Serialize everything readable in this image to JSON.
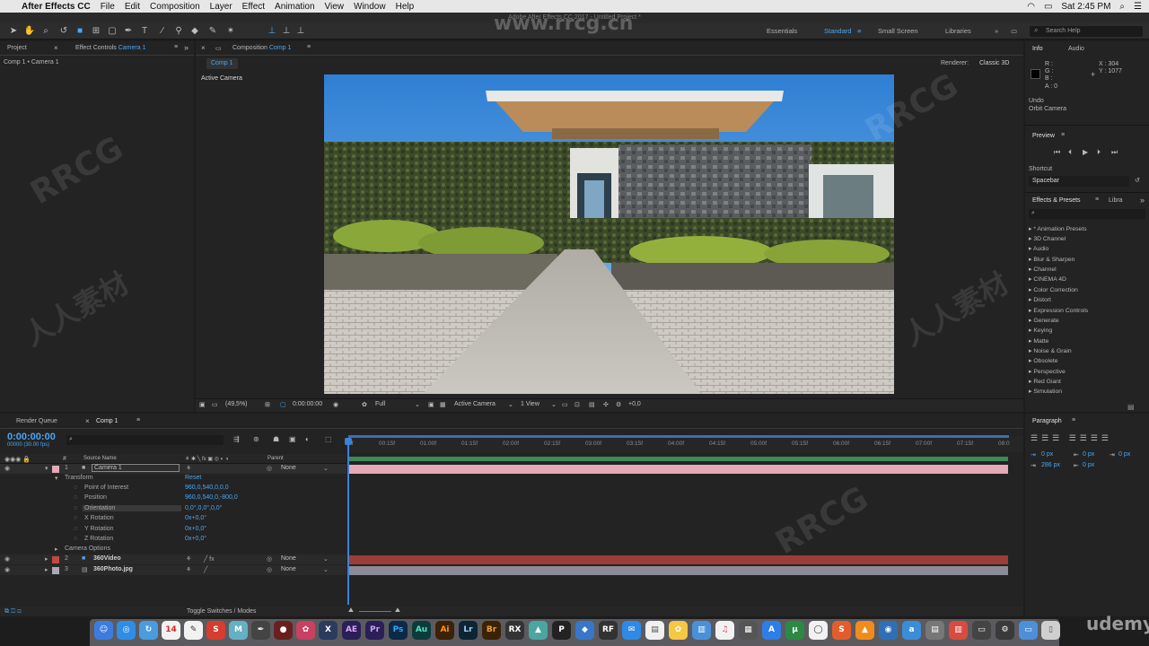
{
  "menubar": {
    "app_name": "After Effects CC",
    "items": [
      "File",
      "Edit",
      "Composition",
      "Layer",
      "Effect",
      "Animation",
      "View",
      "Window",
      "Help"
    ],
    "clock": "Sat 2:45 PM"
  },
  "window_title": "Adobe After Effects CC 2017 - Untitled Project *",
  "workspaces": {
    "essentials": "Essentials",
    "standard": "Standard",
    "small_screen": "Small Screen",
    "libraries": "Libraries"
  },
  "help_search": {
    "placeholder": "Search Help"
  },
  "left_panel": {
    "tab_project": "Project",
    "tab_effect_controls": "Effect Controls",
    "effect_controls_target": "Camera 1",
    "breadcrumb": "Comp 1 • Camera 1"
  },
  "comp_panel": {
    "tab_label": "Composition",
    "tab_target": "Comp 1",
    "subtab": "Comp 1",
    "renderer_label": "Renderer:",
    "renderer_value": "Classic 3D",
    "view_label": "Active Camera",
    "bottom": {
      "zoom": "(49,5%)",
      "timecode": "0:00:00:00",
      "resolution": "Full",
      "camera": "Active Camera",
      "views": "1 View",
      "exposure": "+0,0"
    }
  },
  "info_panel": {
    "tab_info": "Info",
    "tab_audio": "Audio",
    "r": "R :",
    "g": "G :",
    "b": "B :",
    "a": "A : 0",
    "x": "X : 304",
    "y": "Y : 1077",
    "undo_label": "Undo",
    "undo_action": "Orbit Camera"
  },
  "preview_panel": {
    "title": "Preview",
    "shortcut_label": "Shortcut",
    "shortcut_value": "Spacebar"
  },
  "effects_panel": {
    "tab_effects": "Effects & Presets",
    "tab_libraries": "Libra",
    "search_placeholder": "",
    "items": [
      "* Animation Presets",
      "3D Channel",
      "Audio",
      "Blur & Sharpen",
      "Channel",
      "CINEMA 4D",
      "Color Correction",
      "Distort",
      "Expression Controls",
      "Generate",
      "Keying",
      "Matte",
      "Noise & Grain",
      "Obsolete",
      "Perspective",
      "Red Giant",
      "Simulation"
    ]
  },
  "timeline": {
    "tab_render_queue": "Render Queue",
    "tab_comp": "Comp 1",
    "timecode": "0:00:00:00",
    "fps": "00000 (30.00 fps)",
    "col_source_name": "Source Name",
    "col_parent": "Parent",
    "ruler": [
      "0f",
      "00:15f",
      "01:00f",
      "01:15f",
      "02:00f",
      "02:15f",
      "03:00f",
      "03:15f",
      "04:00f",
      "04:15f",
      "05:00f",
      "05:15f",
      "06:00f",
      "06:15f",
      "07:00f",
      "07:15f",
      "08:0"
    ],
    "layers": [
      {
        "num": "1",
        "name": "Camera 1",
        "parent": "None",
        "color": "#e5a9b7"
      },
      {
        "num": "2",
        "name": "360Video",
        "parent": "None",
        "color": "#c04a3f"
      },
      {
        "num": "3",
        "name": "360Photo.jpg",
        "parent": "None",
        "color": "#a8a8b6"
      }
    ],
    "transform_label": "Transform",
    "reset_label": "Reset",
    "properties": [
      {
        "name": "Point of Interest",
        "value": "960,0,540,0,0,0"
      },
      {
        "name": "Position",
        "value": "960,0,540,0,-800,0"
      },
      {
        "name": "Orientation",
        "value": "0,0°,0,0°,0,0°"
      },
      {
        "name": "X Rotation",
        "value": "0x+0,0°"
      },
      {
        "name": "Y Rotation",
        "value": "0x+0,0°"
      },
      {
        "name": "Z Rotation",
        "value": "0x+0,0°"
      }
    ],
    "camera_options": "Camera Options",
    "toggle_label": "Toggle Switches / Modes"
  },
  "paragraph_panel": {
    "title": "Paragraph",
    "indent_1": "0 px",
    "indent_2": "0 px",
    "indent_3": "0 px",
    "space_1": "286 px",
    "space_2": "0 px"
  },
  "dock_apps": [
    "AE",
    "Pr",
    "Ps",
    "Au",
    "Ai",
    "Lr",
    "Br"
  ],
  "watermarks": {
    "site": "www.rrcg.cn",
    "brand": "RRCG",
    "cn": "人人素材",
    "udemy": "udemy"
  },
  "colors": {
    "accent_blue": "#4aa6f2",
    "camera_layer": "#e5a9b7",
    "video_layer": "#c04a3f",
    "photo_layer": "#a8a8b6"
  }
}
